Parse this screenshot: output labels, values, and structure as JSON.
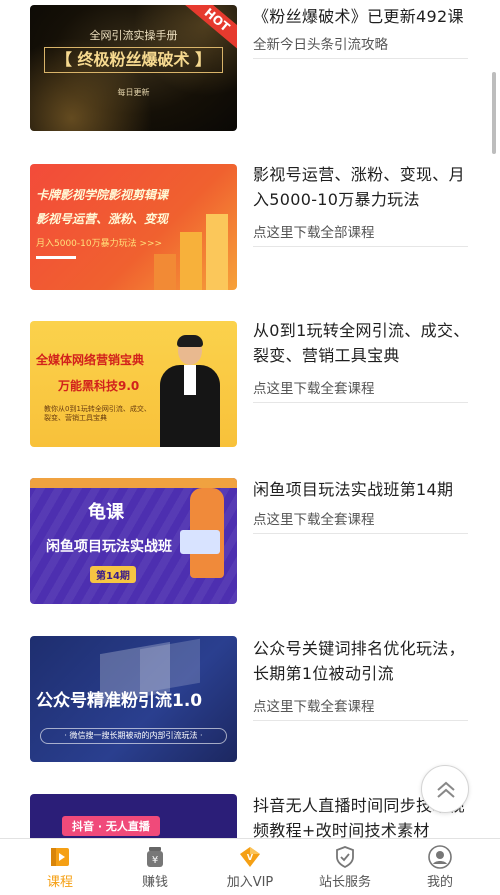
{
  "courses": [
    {
      "title": "《粉丝爆破术》已更新492课",
      "subtitle": "全新今日头条引流攻略",
      "thumb": {
        "hot": "HOT",
        "line1": "全网引流实操手册",
        "line2": "【 终极粉丝爆破术 】",
        "line3": "每日更新"
      }
    },
    {
      "title": "影视号运营、涨粉、变现、月入5000-10万暴力玩法",
      "subtitle": "点这里下载全部课程",
      "thumb": {
        "line1": "卡牌影视学院影视剪辑课",
        "line2": "影视号运营、涨粉、变现",
        "line3": "月入5000-10万暴力玩法 >>>"
      }
    },
    {
      "title": "从0到1玩转全网引流、成交、裂变、营销工具宝典",
      "subtitle": "点这里下载全套课程",
      "thumb": {
        "line1": "全媒体网络营销宝典",
        "line2": "万能黑科技9.0",
        "line3": "教你从0到1玩转全网引流、成交、裂变、营销工具宝典"
      }
    },
    {
      "title": "闲鱼项目玩法实战班第14期",
      "subtitle": "点这里下载全套课程",
      "thumb": {
        "line1": "龟课",
        "line2": "闲鱼项目玩法实战班",
        "line3": "第14期"
      }
    },
    {
      "title": "公众号关键词排名优化玩法，长期第1位被动引流",
      "subtitle": "点这里下载全套课程",
      "thumb": {
        "line1": "公众号精准粉引流1.0",
        "line2": "· 微信搜一搜长期被动的内部引流玩法 ·"
      }
    },
    {
      "title": "抖音无人直播时间同步技术视频教程+改时间技术素材",
      "subtitle": "",
      "thumb": {
        "line1": "抖音 · 无人直播"
      }
    }
  ],
  "tabs": [
    {
      "label": "课程",
      "icon": "book-icon",
      "active": true
    },
    {
      "label": "赚钱",
      "icon": "money-jar-icon",
      "active": false
    },
    {
      "label": "加入VIP",
      "icon": "vip-diamond-icon",
      "active": false
    },
    {
      "label": "站长服务",
      "icon": "shield-icon",
      "active": false
    },
    {
      "label": "我的",
      "icon": "user-icon",
      "active": false
    }
  ],
  "colors": {
    "accent": "#f5a015",
    "text": "#1f1f1f",
    "subtext": "#555555"
  }
}
